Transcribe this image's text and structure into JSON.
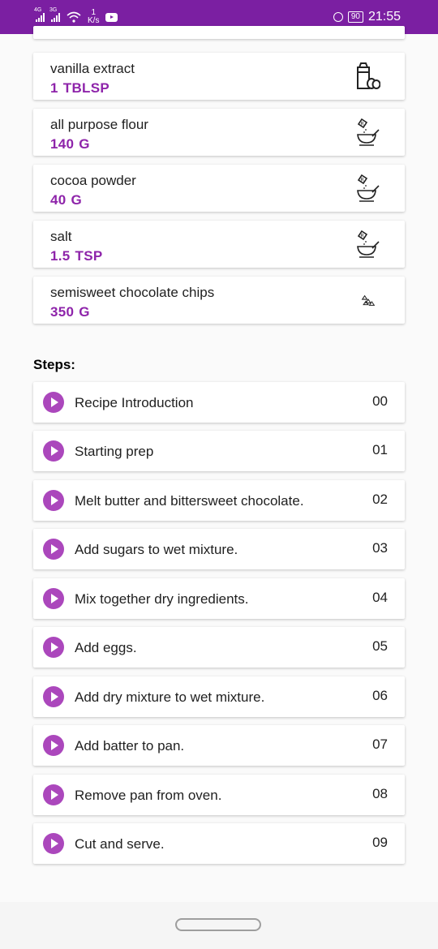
{
  "status_bar": {
    "net1": "4G",
    "net2": "3G",
    "speed_value": "1",
    "speed_unit": "K/s",
    "battery": "90",
    "time": "21:55"
  },
  "ingredients": [
    {
      "name": "vanilla extract",
      "amount": "1",
      "unit": "TBLSP",
      "icon": "milk-and-eggs-icon"
    },
    {
      "name": "all purpose flour",
      "amount": "140",
      "unit": "G",
      "icon": "dry-ingredient-bowl-icon"
    },
    {
      "name": "cocoa powder",
      "amount": "40",
      "unit": "G",
      "icon": "dry-ingredient-bowl-icon"
    },
    {
      "name": "salt",
      "amount": "1.5",
      "unit": "TSP",
      "icon": "dry-ingredient-bowl-icon"
    },
    {
      "name": "semisweet chocolate chips",
      "amount": "350",
      "unit": "G",
      "icon": "chocolate-chips-icon"
    }
  ],
  "steps_heading": "Steps:",
  "steps": [
    {
      "title": "Recipe Introduction",
      "number": "00"
    },
    {
      "title": "Starting prep",
      "number": "01"
    },
    {
      "title": "Melt butter and bittersweet chocolate.",
      "number": "02"
    },
    {
      "title": "Add sugars to wet mixture.",
      "number": "03"
    },
    {
      "title": "Mix together dry ingredients.",
      "number": "04"
    },
    {
      "title": "Add eggs.",
      "number": "05"
    },
    {
      "title": "Add dry mixture to wet mixture.",
      "number": "06"
    },
    {
      "title": "Add batter to pan.",
      "number": "07"
    },
    {
      "title": "Remove pan from oven.",
      "number": "08"
    },
    {
      "title": "Cut and serve.",
      "number": "09"
    }
  ],
  "colors": {
    "accent": "#8e24aa",
    "statusbar": "#7b1fa2",
    "play_button": "#ab47bc"
  }
}
